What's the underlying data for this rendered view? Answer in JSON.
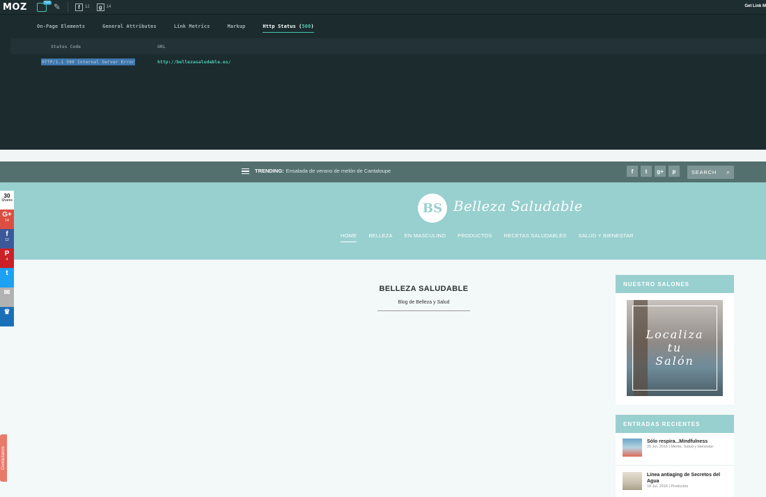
{
  "mozbar": {
    "logo": "MOZ",
    "badge": "500",
    "facebook_count": "12",
    "google_count": "14",
    "get_link": "Get Link M",
    "tabs": [
      {
        "label": "On-Page Elements"
      },
      {
        "label": "General Attributes"
      },
      {
        "label": "Link Metrics"
      },
      {
        "label": "Markup"
      }
    ],
    "active_tab": {
      "label": "Http Status (",
      "count": "500",
      "end": ")"
    },
    "table": {
      "headers": [
        "Status Code",
        "URL"
      ],
      "row": {
        "status": "HTTP/1.1 500 Internal Server Error",
        "url": "http://bellezasaludable.es/"
      }
    }
  },
  "topbar": {
    "trending_label": "TRENDING:",
    "trending_text": "Ensalada de verano de melón de Cantaloupe",
    "social": [
      "f",
      "t",
      "g+",
      "p"
    ],
    "search_label": "SEARCH",
    "search_icon": "⌕"
  },
  "header": {
    "logo_mark": "BS",
    "logo_text": "Belleza Saludable",
    "nav": [
      "HOME",
      "BELLEZA",
      "EN MASCULINO",
      "PRODUCTOS",
      "RECETAS SALUDABLES",
      "SALUD Y BIENESTAR"
    ]
  },
  "main": {
    "title": "BELLEZA SALUDABLE",
    "subtitle": "Blog de Belleza y Salud"
  },
  "sidebar": {
    "salones_title": "NUESTRO SALONES",
    "salon_lines": [
      "Localiza",
      "tu",
      "Salón"
    ],
    "recent_title": "ENTRADAS RECIENTES",
    "posts": [
      {
        "title": "Sólo respira...Mindfulness",
        "meta": "25 Jul, 2016 | Mente, Salud y bienestar"
      },
      {
        "title": "Línea antiaging de Secretos del Agua",
        "meta": "18 Jul, 2016 | Productos"
      }
    ]
  },
  "share": {
    "count": "30",
    "count_label": "Shares",
    "buttons": [
      {
        "name": "google-plus",
        "glyph": "G+",
        "count": "14",
        "color": "#dc4e41"
      },
      {
        "name": "facebook",
        "glyph": "f",
        "count": "12",
        "color": "#3b5998"
      },
      {
        "name": "pinterest",
        "glyph": "P",
        "count": "4",
        "color": "#cb2027"
      },
      {
        "name": "twitter",
        "glyph": "t",
        "count": "",
        "color": "#1da1f2"
      },
      {
        "name": "email",
        "glyph": "✉",
        "count": "",
        "color": "#b2b2b2"
      },
      {
        "name": "sumome",
        "glyph": "♛",
        "count": "",
        "color": "#1a70b8"
      }
    ],
    "contact": "Contáctanos"
  }
}
